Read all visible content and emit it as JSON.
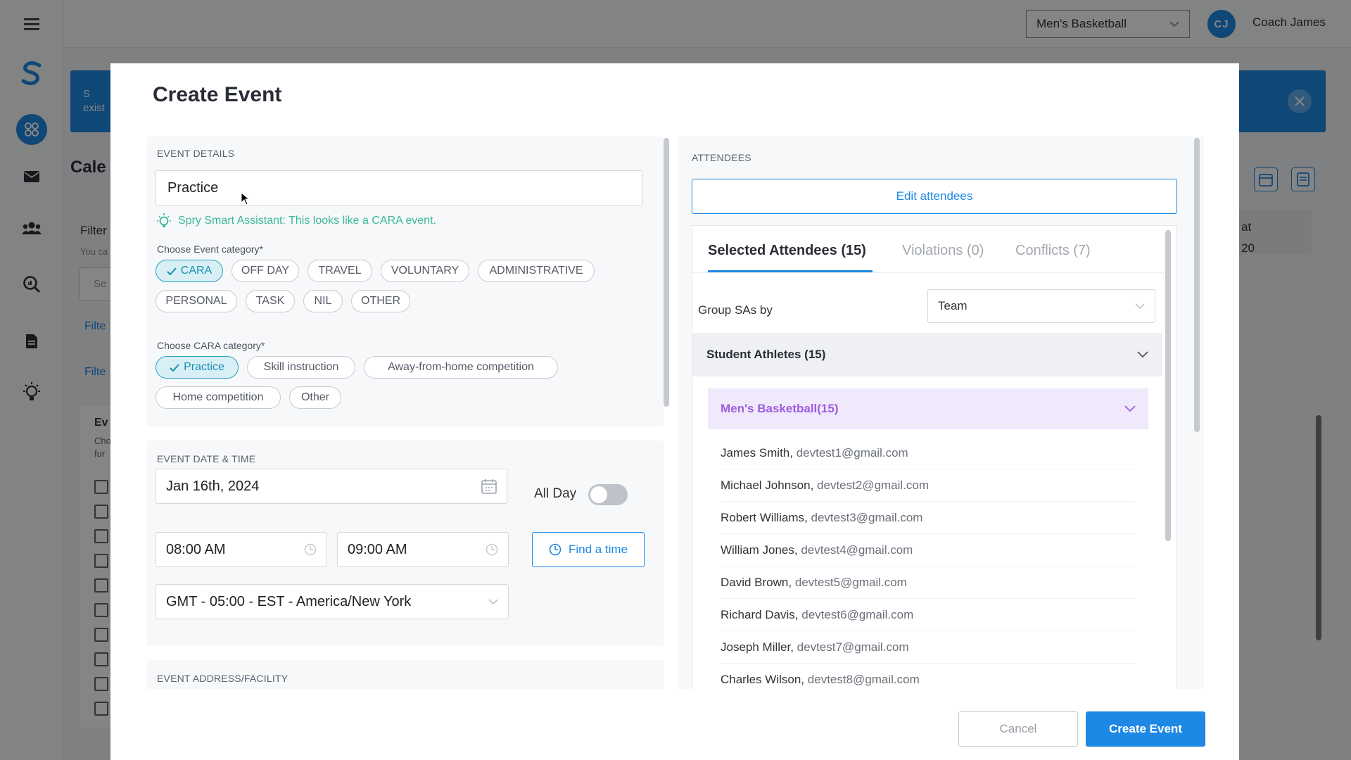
{
  "app": {
    "team_select": "Men's Basketball",
    "avatar_initials": "CJ",
    "user_name": "Coach James",
    "banner_line1": "S",
    "banner_line2": "exist",
    "page_title": "Cale",
    "filter_label": "Filter",
    "filter_sub": "You ca",
    "search_placeholder": "Se",
    "filter_link1": "Filte",
    "filter_link2": "Filte",
    "events_title": "Ev",
    "events_sub1": "Cho",
    "events_sub2": "fur",
    "right_panel_line1": "at",
    "right_panel_line2": "20"
  },
  "modal": {
    "title": "Create Event",
    "event_details": {
      "section_label": "EVENT DETAILS",
      "title_value": "Practice",
      "assistant_text": "Spry Smart Assistant: This looks like a CARA event.",
      "category_label": "Choose Event category*",
      "categories": [
        "CARA",
        "OFF DAY",
        "TRAVEL",
        "VOLUNTARY",
        "ADMINISTRATIVE",
        "PERSONAL",
        "TASK",
        "NIL",
        "OTHER"
      ],
      "selected_category": "CARA",
      "cara_label": "Choose CARA category*",
      "cara_categories": [
        "Practice",
        "Skill instruction",
        "Away-from-home competition",
        "Home competition",
        "Other"
      ],
      "selected_cara": "Practice"
    },
    "date_time": {
      "section_label": "EVENT DATE & TIME",
      "date": "Jan 16th, 2024",
      "all_day_label": "All Day",
      "all_day": false,
      "start_time": "08:00 AM",
      "end_time": "09:00 AM",
      "find_time": "Find a time",
      "timezone": "GMT - 05:00 - EST - America/New York"
    },
    "address": {
      "section_label": "EVENT ADDRESS/FACILITY"
    },
    "attendees": {
      "section_label": "ATTENDEES",
      "edit_button": "Edit attendees",
      "tabs": [
        "Selected Attendees (15)",
        "Violations (0)",
        "Conflicts (7)"
      ],
      "group_label": "Group SAs by",
      "group_value": "Team",
      "student_athletes_header": "Student Athletes (15)",
      "team_header": "Men's Basketball(15)",
      "athletes": [
        {
          "name": "James Smith,",
          "email": "devtest1@gmail.com"
        },
        {
          "name": "Michael Johnson,",
          "email": "devtest2@gmail.com"
        },
        {
          "name": "Robert Williams,",
          "email": "devtest3@gmail.com"
        },
        {
          "name": "William Jones,",
          "email": "devtest4@gmail.com"
        },
        {
          "name": "David Brown,",
          "email": "devtest5@gmail.com"
        },
        {
          "name": "Richard Davis,",
          "email": "devtest6@gmail.com"
        },
        {
          "name": "Joseph Miller,",
          "email": "devtest7@gmail.com"
        },
        {
          "name": "Charles Wilson,",
          "email": "devtest8@gmail.com"
        }
      ]
    },
    "cancel_button": "Cancel",
    "create_button": "Create Event"
  },
  "colors": {
    "accent": "#1e88e5",
    "assistant": "#39b89a",
    "selected_chip": "#1a8fb0",
    "team_header": "#9c5ee0"
  },
  "icons": [
    "hamburger-icon",
    "logo-icon",
    "dashboard-icon",
    "mail-icon",
    "users-icon",
    "search-analytics-icon",
    "document-icon",
    "lightbulb-icon",
    "calendar-icon",
    "clock-icon",
    "chevron-down-icon",
    "check-icon",
    "close-icon"
  ]
}
